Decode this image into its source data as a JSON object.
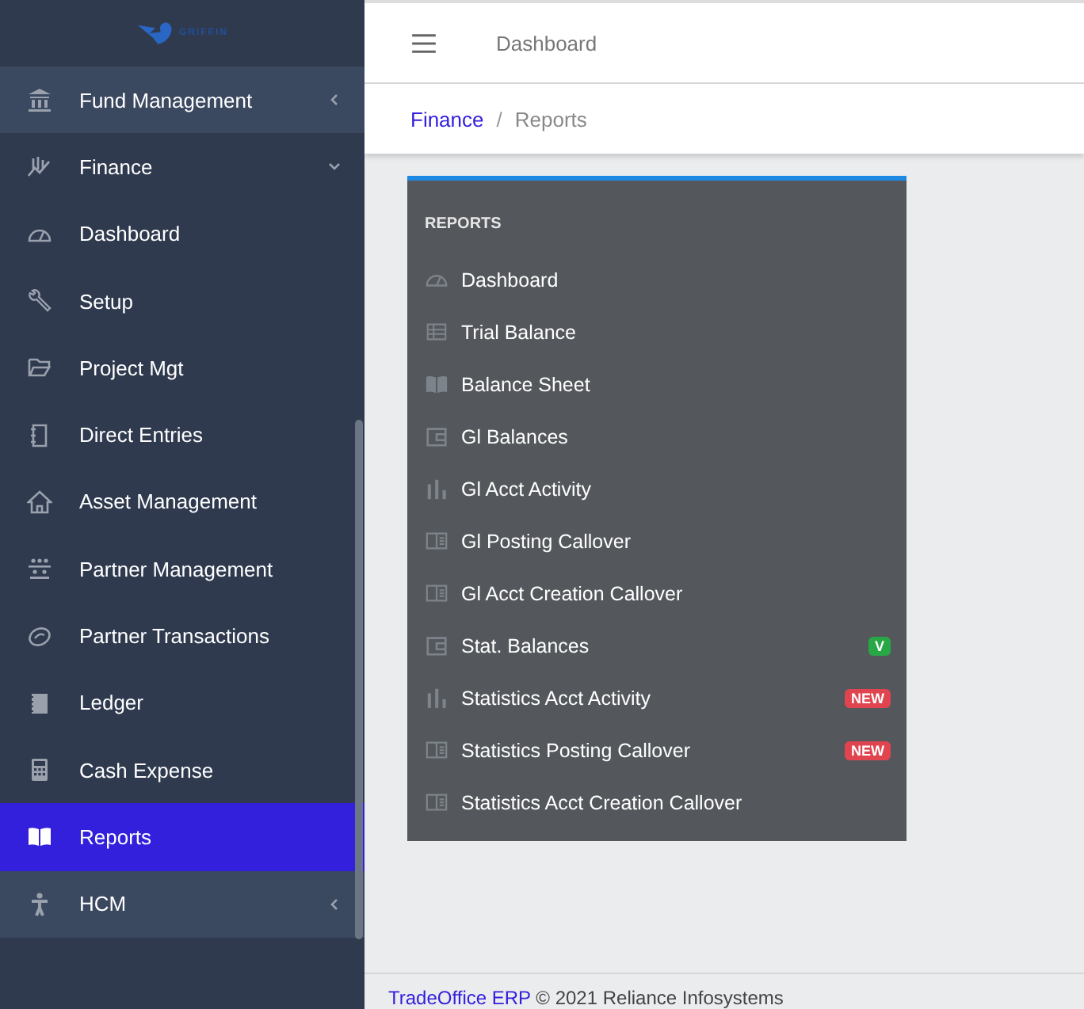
{
  "brand": {
    "logo_text": "GRIFFIN"
  },
  "sidebar": {
    "items": [
      {
        "label": "Fund Management",
        "expanded": false,
        "selected": false
      },
      {
        "label": "Finance",
        "expanded": true,
        "selected": false,
        "children": [
          {
            "label": "Dashboard",
            "selected": false
          },
          {
            "label": "Setup",
            "selected": false
          },
          {
            "label": "Project Mgt",
            "selected": false
          },
          {
            "label": "Direct Entries",
            "selected": false
          },
          {
            "label": "Asset Management",
            "selected": false
          },
          {
            "label": "Partner Management",
            "selected": false
          },
          {
            "label": "Partner Transactions",
            "selected": false
          },
          {
            "label": "Ledger",
            "selected": false
          },
          {
            "label": "Cash Expense",
            "selected": false
          },
          {
            "label": "Reports",
            "selected": true
          }
        ]
      },
      {
        "label": "HCM",
        "expanded": false,
        "selected": false
      }
    ]
  },
  "header": {
    "title": "Dashboard"
  },
  "breadcrumb": {
    "separator": "/",
    "items": [
      {
        "label": "Finance",
        "kind": "link"
      },
      {
        "label": "Reports",
        "kind": "current"
      }
    ]
  },
  "reports_menu": {
    "heading": "REPORTS",
    "items": [
      {
        "label": "Dashboard"
      },
      {
        "label": "Trial Balance"
      },
      {
        "label": "Balance Sheet"
      },
      {
        "label": "Gl Balances"
      },
      {
        "label": "Gl Acct Activity"
      },
      {
        "label": "Gl Posting Callover"
      },
      {
        "label": "Gl Acct Creation Callover"
      },
      {
        "label": "Stat. Balances",
        "badge": {
          "text": "V",
          "color": "#28a745"
        }
      },
      {
        "label": "Statistics Acct Activity",
        "badge": {
          "text": "NEW",
          "color": "#e0444f"
        }
      },
      {
        "label": "Statistics Posting Callover",
        "badge": {
          "text": "NEW",
          "color": "#e0444f"
        }
      },
      {
        "label": "Statistics Acct Creation Callover"
      }
    ]
  },
  "footer": {
    "link": "TradeOffice ERP",
    "text": "© 2021 Reliance Infosystems"
  }
}
